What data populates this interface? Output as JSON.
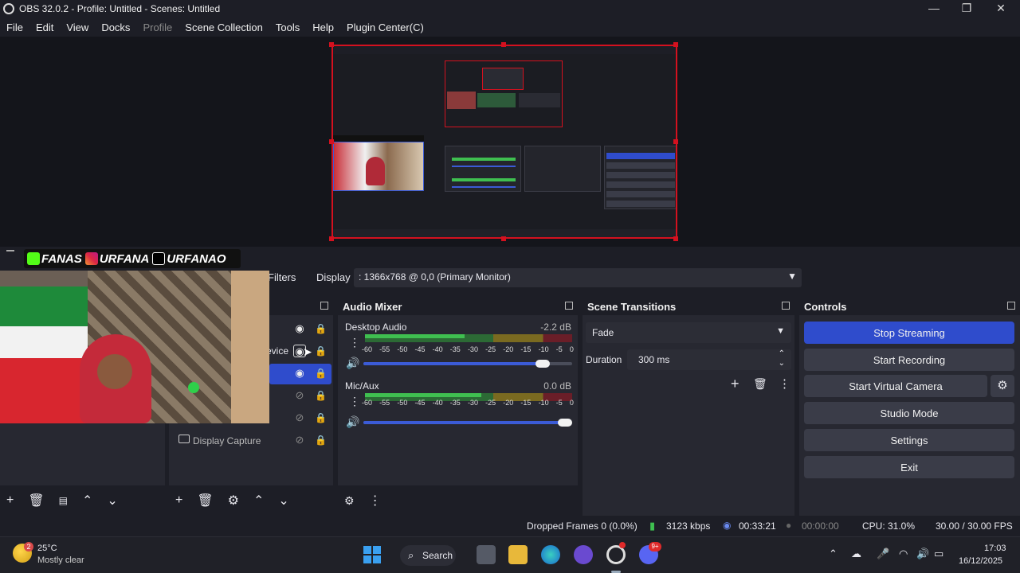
{
  "window": {
    "title": "OBS 32.0.2 - Profile: Untitled - Scenes: Untitled"
  },
  "menu": [
    "File",
    "Edit",
    "View",
    "Docks",
    "Profile",
    "Scene Collection",
    "Tools",
    "Help",
    "Plugin Center(C)"
  ],
  "overlay": {
    "handle1": "FANAS",
    "handle2": "URFANA",
    "handle3": "URFANAO"
  },
  "toolbar": {
    "filters_label": "Filters",
    "display_label": "Display",
    "display_value": ": 1366x768 @ 0,0 (Primary Monitor)"
  },
  "sources": {
    "partial_label": "evice",
    "display_capture": "Display Capture"
  },
  "audio_mixer": {
    "title": "Audio Mixer",
    "channels": [
      {
        "name": "Desktop Audio",
        "db": "-2.2 dB",
        "volume": 0.89
      },
      {
        "name": "Mic/Aux",
        "db": "0.0 dB",
        "volume": 1.0
      }
    ],
    "ticks": [
      "-60",
      "-55",
      "-50",
      "-45",
      "-40",
      "-35",
      "-30",
      "-25",
      "-20",
      "-15",
      "-10",
      "-5",
      "0"
    ]
  },
  "scene_transitions": {
    "title": "Scene Transitions",
    "transition": "Fade",
    "duration_label": "Duration",
    "duration_value": "300 ms"
  },
  "controls": {
    "title": "Controls",
    "stop_streaming": "Stop Streaming",
    "start_recording": "Start Recording",
    "start_virtual_camera": "Start Virtual Camera",
    "studio_mode": "Studio Mode",
    "settings": "Settings",
    "exit": "Exit",
    "accent": "#2f4ccc"
  },
  "status": {
    "dropped_frames": "Dropped Frames 0 (0.0%)",
    "bitrate": "3123 kbps",
    "stream_time": "00:33:21",
    "record_time": "00:00:00",
    "cpu": "CPU: 31.0%",
    "fps": "30.00 / 30.00 FPS"
  },
  "taskbar": {
    "weather_temp": "25°C",
    "weather_desc": "Mostly clear",
    "weather_badge": "2",
    "search_label": "Search",
    "discord_badge": "9+",
    "time": "17:03",
    "date": "16/12/2025"
  }
}
